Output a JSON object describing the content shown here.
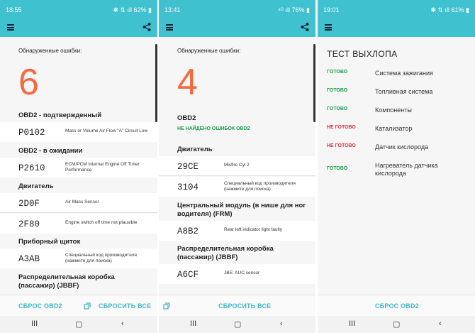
{
  "colors": {
    "accent": "#3fc1d0",
    "big_number": "#f26a3d",
    "ok": "#1a9f4a",
    "not_ok": "#e0303a",
    "button_text": "#3fb6c6"
  },
  "screens": [
    {
      "status_time": "18:55",
      "status_icons": "✱ ⇅ ıll 62% ▮",
      "found_label": "Обнаруженные ошибки:",
      "count": "6",
      "sections": [
        {
          "title": "OBD2 - подтвержденный",
          "rows": [
            {
              "code": "P0102",
              "desc": "Mass or Volume Air Flow \"A\" Circuit Low"
            }
          ]
        },
        {
          "title": "OBD2 - в ожидании",
          "rows": [
            {
              "code": "P2610",
              "desc": "ECM/PCM Internal Engine Off Timer Performance"
            }
          ]
        },
        {
          "title": "Двигатель",
          "rows": [
            {
              "code": "2D0F",
              "desc": "Air Mass Sensor"
            },
            {
              "code": "2F80",
              "desc": "Engine switch off time not plausible"
            }
          ]
        },
        {
          "title": "Приборный щиток",
          "rows": [
            {
              "code": "A3AB",
              "desc": "Специальный код производителя (нажмите для поиска)"
            }
          ]
        },
        {
          "title": "Распределительная коробка (пассажир) (JBBF)",
          "rows": []
        }
      ],
      "reset_obd2": "СБРОС OBD2",
      "reset_all": "СБРОСИТЬ ВСЕ"
    },
    {
      "status_time": "13:41",
      "status_icons": "⁴ᴳ ıll 76% ▮",
      "found_label": "Обнаруженные ошибки:",
      "count": "4",
      "obd2_title": "OBD2",
      "no_errors": "НЕ НАЙДЕНО ОШИБОК OBD2",
      "sections": [
        {
          "title": "Двигатель",
          "rows": [
            {
              "code": "29CE",
              "desc": "Misfire Cyl 2"
            },
            {
              "code": "3104",
              "desc": "Специальный код производителя (нажмите для поиска)"
            }
          ]
        },
        {
          "title": "Центральный модуль (в нише для ног водителя) (FRM)",
          "rows": [
            {
              "code": "A8B2",
              "desc": "Rear left indicator light faulty"
            }
          ]
        },
        {
          "title": "Распределительная коробка (пассажир) (JBBF)",
          "rows": [
            {
              "code": "A6CF",
              "desc": "JBE: AUC sensor"
            }
          ]
        }
      ],
      "reset_all": "СБРОСИТЬ ВСЕ"
    },
    {
      "status_time": "19:01",
      "status_icons": "✱ ⇅ ıll 61% ▮",
      "title": "ТЕСТ ВЫХЛОПА",
      "readiness": [
        {
          "status": "ГОТОВО",
          "ok": true,
          "component": "Система зажигания"
        },
        {
          "status": "ГОТОВО",
          "ok": true,
          "component": "Топливная система"
        },
        {
          "status": "ГОТОВО",
          "ok": true,
          "component": "Компоненты"
        },
        {
          "status": "НЕ ГОТОВО",
          "ok": false,
          "component": "Катализатор"
        },
        {
          "status": "НЕ ГОТОВО",
          "ok": false,
          "component": "Датчик кислорода"
        },
        {
          "status": "ГОТОВО",
          "ok": true,
          "component": "Нагреватель датчика кислорода"
        }
      ],
      "reset_obd2": "СБРОС OBD2"
    }
  ],
  "nav": {
    "recent": "III",
    "home": "▢",
    "back": "‹"
  }
}
